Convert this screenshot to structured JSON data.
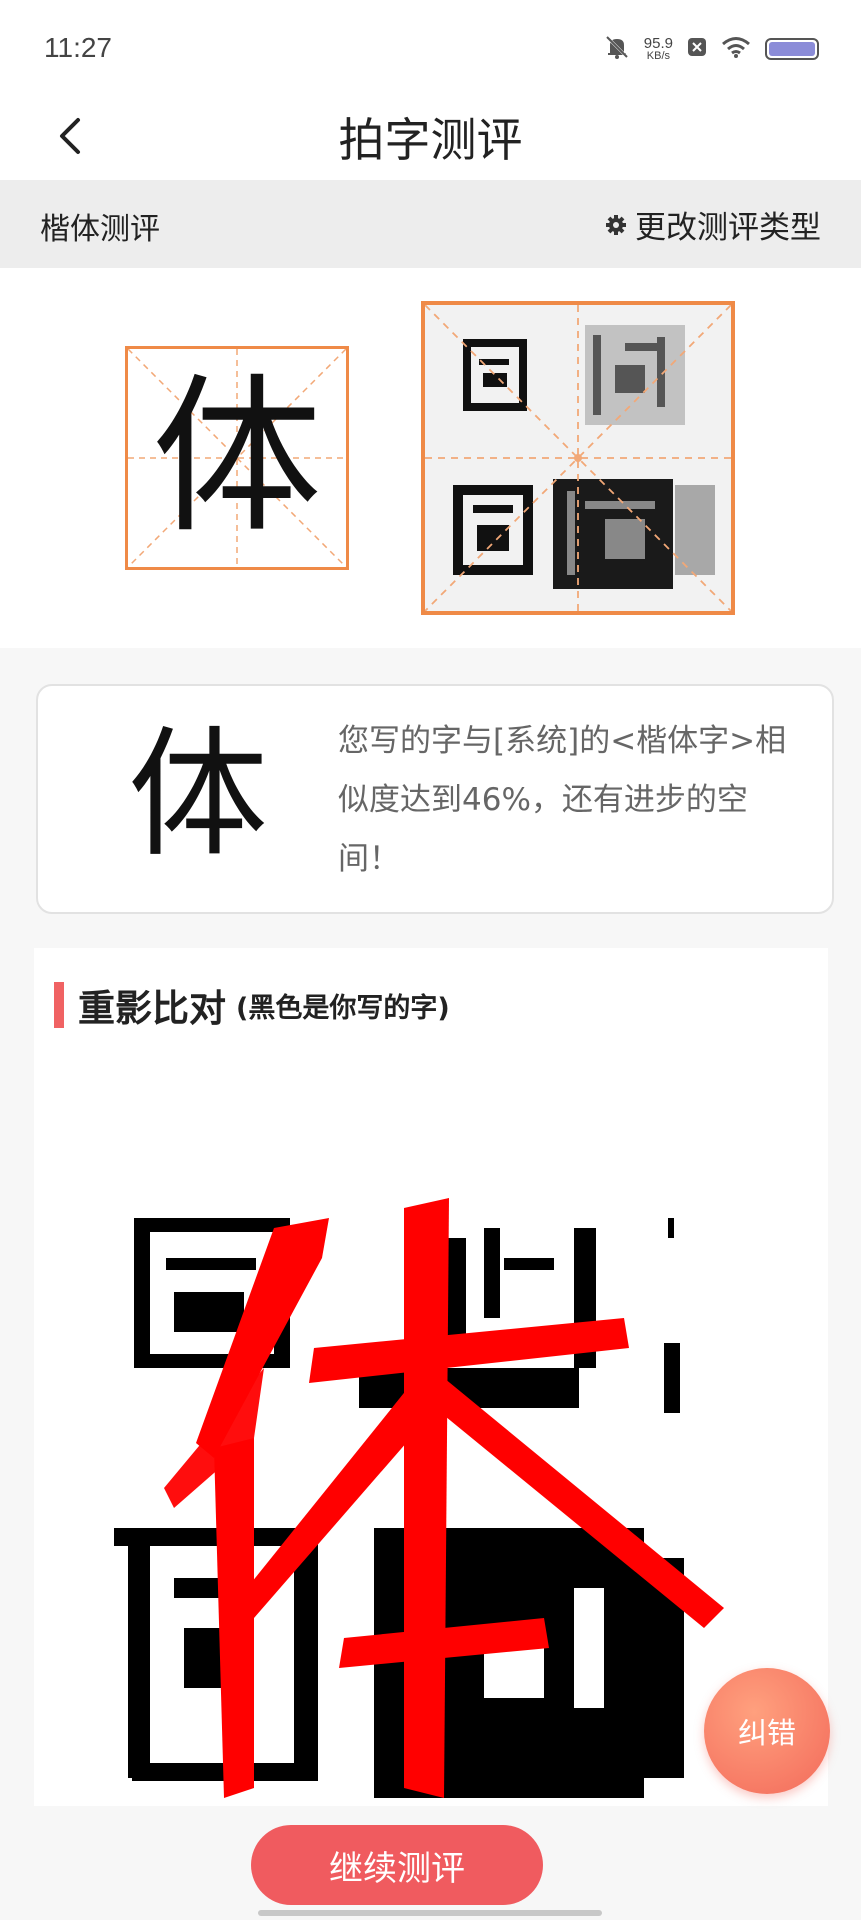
{
  "status_bar": {
    "time": "11:27",
    "net_speed_value": "95.9",
    "net_speed_unit": "KB/s",
    "icons": [
      "mute-bell-icon",
      "close-box-icon",
      "wifi-icon",
      "battery-icon"
    ]
  },
  "nav": {
    "back_icon": "chevron-left-icon",
    "title": "拍字测评"
  },
  "type_bar": {
    "current_type": "楷体测评",
    "change_label": "更改测评类型",
    "change_icon": "gear-icon"
  },
  "preview": {
    "standard_char": "体",
    "grid_color": "#ef8a47"
  },
  "result": {
    "char": "体",
    "message": "您写的字与[系统]的<楷体字>相似度达到46%，还有进步的空间！"
  },
  "overlay": {
    "title": "重影比对",
    "subtitle": "(黑色是你写的字)",
    "accent_color": "#f06263",
    "overlay_char": "体",
    "overlay_color": "#ff0000"
  },
  "buttons": {
    "correct": "纠错",
    "continue": "继续测评",
    "primary_color": "#f05b5f"
  }
}
